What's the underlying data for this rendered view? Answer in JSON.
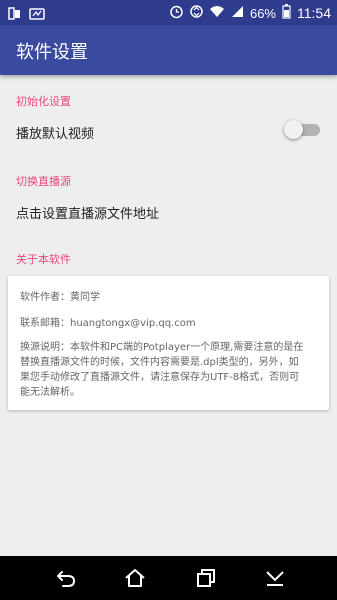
{
  "status_bar": {
    "battery": "66%",
    "time": "11:54"
  },
  "app_bar": {
    "title": "软件设置"
  },
  "sections": {
    "init": {
      "header": "初始化设置",
      "autoplay_label": "播放默认视频",
      "autoplay_enabled": false
    },
    "source": {
      "header": "切换直播源",
      "set_source_label": "点击设置直播源文件地址"
    },
    "about": {
      "header": "关于本软件",
      "author": "软件作者：黄同学",
      "email": "联系邮箱：huangtongx@vip.qq.com",
      "note_line1": "换源说明：本软件和PC端的Potplayer一个原理,需要注意的是在",
      "note_line2": "替换直播源文件的时候，文件内容需要是.dpl类型的，另外，如",
      "note_line3": "果您手动修改了直播源文件，请注意保存为UTF-8格式，否则可",
      "note_line4": "能无法解析。"
    }
  },
  "colors": {
    "status_bar": "#2f3c8e",
    "app_bar": "#3a4a9f",
    "accent": "#e94a7c",
    "background": "#eeeeee"
  },
  "icons": [
    "sim-icon",
    "notification-icon",
    "alarm-icon",
    "data-icon",
    "wifi-icon",
    "signal-icon",
    "battery-icon",
    "back-icon",
    "home-icon",
    "recents-icon",
    "menu-down-icon"
  ]
}
